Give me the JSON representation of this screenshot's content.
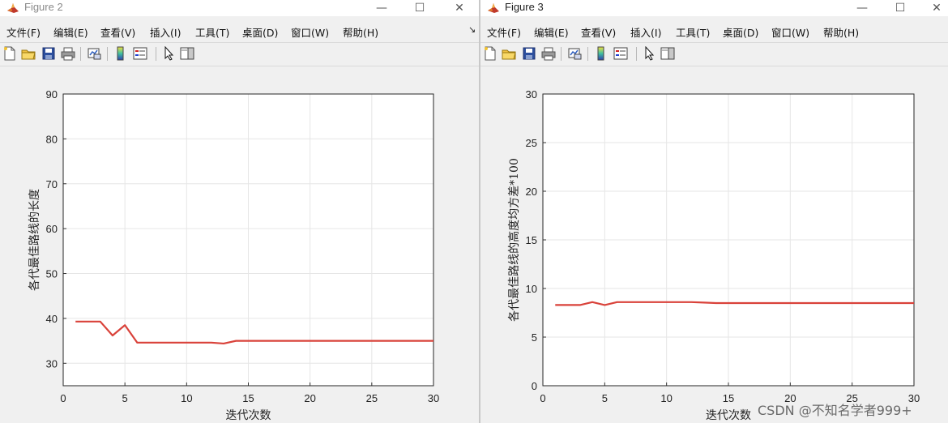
{
  "figures": [
    {
      "title": "Figure 2",
      "menu": [
        "文件(F)",
        "编辑(E)",
        "查看(V)",
        "插入(I)",
        "工具(T)",
        "桌面(D)",
        "窗口(W)",
        "帮助(H)"
      ]
    },
    {
      "title": "Figure 3",
      "menu": [
        "文件(F)",
        "编辑(E)",
        "查看(V)",
        "插入(I)",
        "工具(T)",
        "桌面(D)",
        "窗口(W)",
        "帮助(H)"
      ]
    }
  ],
  "toolbar_icons": [
    "new-file-icon",
    "open-folder-icon",
    "save-icon",
    "print-icon",
    "link-plot-icon",
    "colorbar-icon",
    "legend-icon",
    "pointer-icon",
    "property-editor-icon"
  ],
  "window_controls": {
    "minimize": "—",
    "maximize": "☐",
    "close": "✕"
  },
  "watermark": "CSDN @不知名学者999+",
  "colors": {
    "line": "#d9423a",
    "grid": "#e6e6e6",
    "axes_bg": "#ffffff",
    "window_bg": "#f0f0f0"
  },
  "chart_data": [
    {
      "type": "line",
      "xlabel": "迭代次数",
      "ylabel": "各代最佳路线的长度",
      "xlim": [
        0,
        30
      ],
      "ylim": [
        25,
        90
      ],
      "xticks": [
        0,
        5,
        10,
        15,
        20,
        25,
        30
      ],
      "yticks": [
        30,
        40,
        50,
        60,
        70,
        80,
        90
      ],
      "grid": true,
      "x": [
        1,
        2,
        3,
        4,
        5,
        6,
        7,
        8,
        9,
        10,
        11,
        12,
        13,
        14,
        15,
        16,
        17,
        18,
        19,
        20,
        21,
        22,
        23,
        24,
        25,
        26,
        27,
        28,
        29,
        30
      ],
      "y": [
        39.3,
        39.3,
        39.3,
        36.2,
        38.5,
        34.6,
        34.6,
        34.6,
        34.6,
        34.6,
        34.6,
        34.6,
        34.4,
        35.0,
        35.0,
        35.0,
        35.0,
        35.0,
        35.0,
        35.0,
        35.0,
        35.0,
        35.0,
        35.0,
        35.0,
        35.0,
        35.0,
        35.0,
        35.0,
        35.0
      ]
    },
    {
      "type": "line",
      "xlabel": "迭代次数",
      "ylabel": "各代最佳路线的高度均方差*100",
      "xlim": [
        0,
        30
      ],
      "ylim": [
        0,
        30
      ],
      "xticks": [
        0,
        5,
        10,
        15,
        20,
        25,
        30
      ],
      "yticks": [
        0,
        5,
        10,
        15,
        20,
        25,
        30
      ],
      "grid": true,
      "x": [
        1,
        2,
        3,
        4,
        5,
        6,
        7,
        8,
        9,
        10,
        11,
        12,
        13,
        14,
        15,
        16,
        17,
        18,
        19,
        20,
        21,
        22,
        23,
        24,
        25,
        26,
        27,
        28,
        29,
        30
      ],
      "y": [
        8.3,
        8.3,
        8.3,
        8.6,
        8.3,
        8.6,
        8.6,
        8.6,
        8.6,
        8.6,
        8.6,
        8.6,
        8.55,
        8.5,
        8.5,
        8.5,
        8.5,
        8.5,
        8.5,
        8.5,
        8.5,
        8.5,
        8.5,
        8.5,
        8.5,
        8.5,
        8.5,
        8.5,
        8.5,
        8.5
      ]
    }
  ]
}
